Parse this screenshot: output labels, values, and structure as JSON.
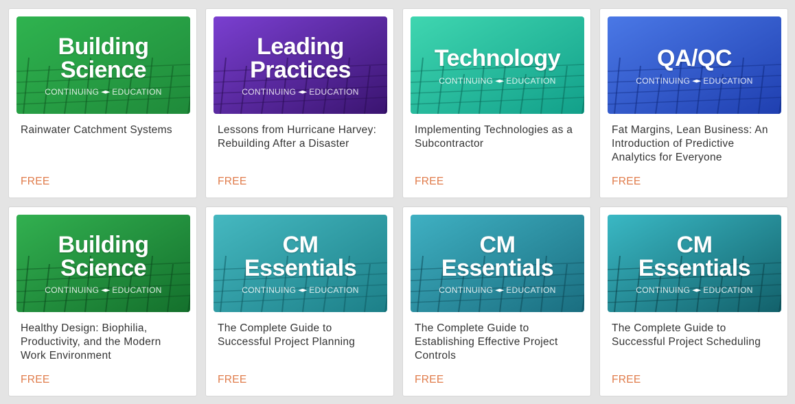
{
  "courses": [
    {
      "banner": [
        "Building",
        "Science"
      ],
      "subtitle": "CONTINUING EDUCATION",
      "cap_icon": "graduation-cap-icon",
      "theme": "green",
      "title": "Rainwater Catchment Systems",
      "price": "FREE"
    },
    {
      "banner": [
        "Leading",
        "Practices"
      ],
      "subtitle": "CONTINUING EDUCATION",
      "cap_icon": "graduation-cap-icon",
      "theme": "purple",
      "title": "Lessons from Hurricane Harvey: Rebuilding After a Disaster",
      "price": "FREE"
    },
    {
      "banner": [
        "Technology"
      ],
      "subtitle": "CONTINUING EDUCATION",
      "cap_icon": "graduation-cap-icon",
      "theme": "teal",
      "title": "Implementing Technologies as a Subcontractor",
      "price": "FREE"
    },
    {
      "banner": [
        "QA/QC"
      ],
      "subtitle": "CONTINUING EDUCATION",
      "cap_icon": "graduation-cap-icon",
      "theme": "blue",
      "title": "Fat Margins, Lean Business: An Introduction of Predictive Analytics for Everyone",
      "price": "FREE"
    },
    {
      "banner": [
        "Building",
        "Science"
      ],
      "subtitle": "CONTINUING EDUCATION",
      "cap_icon": "graduation-cap-icon",
      "theme": "green2",
      "title": "Healthy Design: Biophilia, Productivity, and the Modern Work Environment",
      "price": "FREE"
    },
    {
      "banner": [
        "CM",
        "Essentials"
      ],
      "subtitle": "CONTINUING EDUCATION",
      "cap_icon": "graduation-cap-icon",
      "theme": "cyan",
      "title": "The Complete Guide to Successful Project Planning",
      "price": "FREE"
    },
    {
      "banner": [
        "CM",
        "Essentials"
      ],
      "subtitle": "CONTINUING EDUCATION",
      "cap_icon": "graduation-cap-icon",
      "theme": "cyan2",
      "title": "The Complete Guide to Establishing Effective Project Controls",
      "price": "FREE"
    },
    {
      "banner": [
        "CM",
        "Essentials"
      ],
      "subtitle": "CONTINUING EDUCATION",
      "cap_icon": "graduation-cap-icon",
      "theme": "cyan3",
      "title": "The Complete Guide to Successful Project Scheduling",
      "price": "FREE"
    }
  ],
  "themes": {
    "green": {
      "a": "#1f8a3a",
      "b": "#2fb34f",
      "line": "#0f5a22"
    },
    "purple": {
      "a": "#3a1470",
      "b": "#7a3fd0",
      "line": "#2a0d55"
    },
    "teal": {
      "a": "#12a08a",
      "b": "#3fd6b0",
      "line": "#0a6a5a"
    },
    "blue": {
      "a": "#1f3fb0",
      "b": "#4a78e6",
      "line": "#102a80"
    },
    "green2": {
      "a": "#14702c",
      "b": "#32b050",
      "line": "#0a4a1c"
    },
    "cyan": {
      "a": "#1c7f88",
      "b": "#45b8c0",
      "line": "#0f5a62"
    },
    "cyan2": {
      "a": "#1a6e80",
      "b": "#3fb0c2",
      "line": "#0e4a58"
    },
    "cyan3": {
      "a": "#12606a",
      "b": "#3ab8c4",
      "line": "#0a4048"
    }
  },
  "price_color": "#e07b4a"
}
